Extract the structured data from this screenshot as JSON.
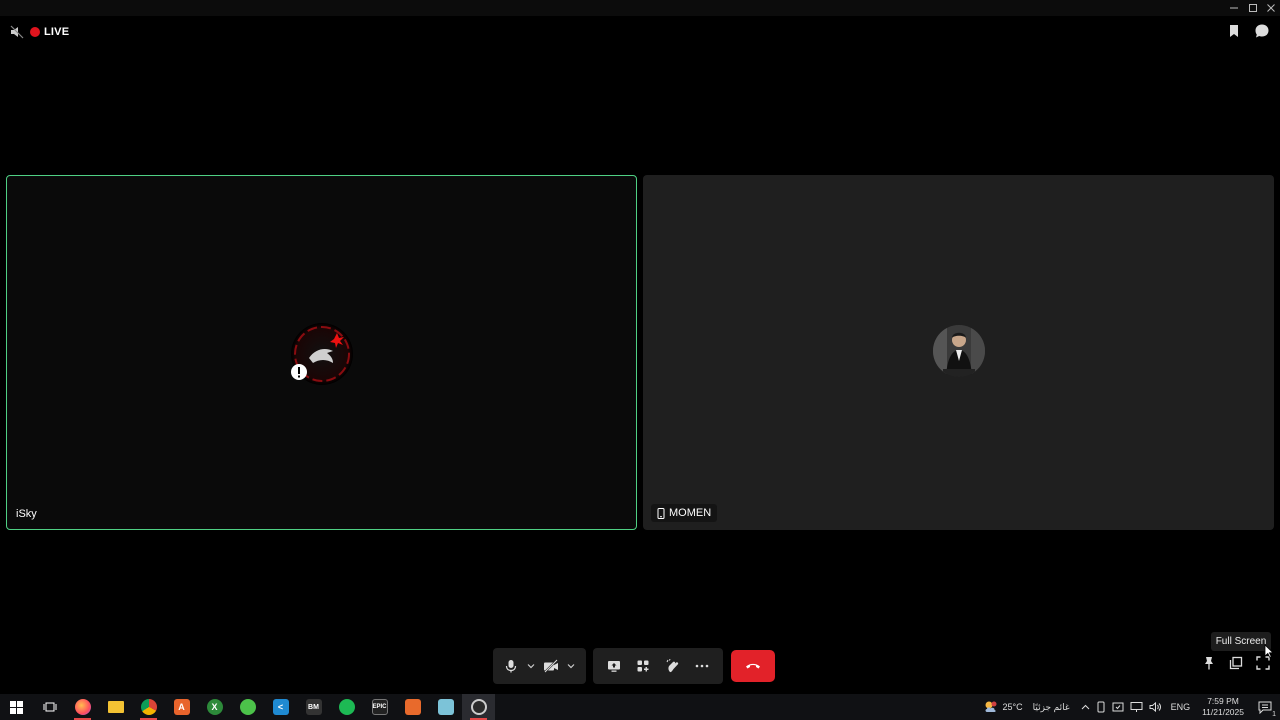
{
  "window": {
    "controls": [
      "minimize",
      "maximize",
      "close"
    ]
  },
  "topbar": {
    "live_label": "LIVE",
    "live_color": "#e0141e"
  },
  "participants": [
    {
      "name": "iSky",
      "active_speaker": true,
      "border_color": "#4fd084"
    },
    {
      "name": "MOMEN",
      "device_icon": "phone-icon"
    }
  ],
  "tooltip": {
    "text": "Full Screen"
  },
  "toolbar": {
    "end_call_color": "#e22229"
  },
  "taskbar": {
    "apps": [
      "start",
      "task-view",
      "firefox",
      "file-explorer",
      "chrome",
      "ardour",
      "xbox",
      "browser",
      "vscode",
      "bm",
      "spotify",
      "epic",
      "app",
      "notepad",
      "obs"
    ],
    "weather": {
      "temp": "25°C",
      "condition": "غائم جزئيًا"
    },
    "language": "ENG",
    "time": "7:59 PM",
    "date": "11/21/2025",
    "notification_count": "1"
  }
}
